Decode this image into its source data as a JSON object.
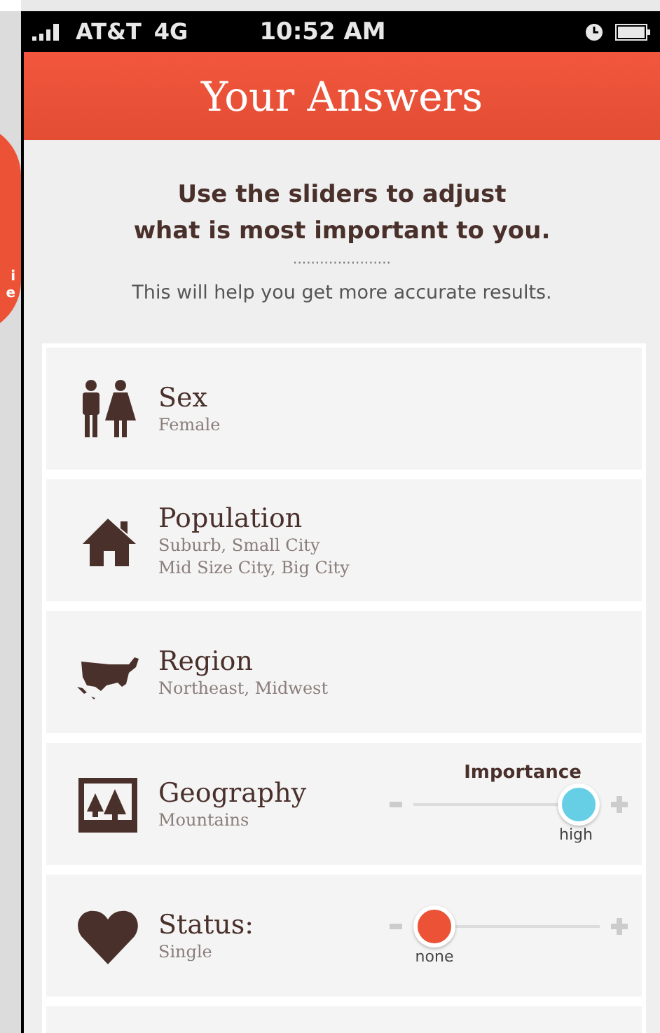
{
  "background_screen": {
    "badge_lines": [
      "i",
      "e"
    ]
  },
  "status_bar": {
    "carrier": "AT&T",
    "network": "4G",
    "time": "10:52 AM"
  },
  "header": {
    "title": "Your Answers"
  },
  "intro": {
    "heading_lines": [
      "Use the sliders to adjust",
      "what is most important to you."
    ],
    "divider": "......................",
    "subtitle": "This will help you get more accurate results."
  },
  "answers": [
    {
      "kind": "plain",
      "title": "Sex",
      "values": [
        "Female"
      ]
    },
    {
      "kind": "plain",
      "title": "Population",
      "values": [
        "Suburb, Small City",
        "Mid Size City, Big City"
      ]
    },
    {
      "kind": "plain",
      "title": "Region",
      "values": [
        "Northeast, Midwest"
      ]
    },
    {
      "kind": "slider",
      "title": "Geography",
      "values": [
        "Mountains"
      ],
      "slider_title": "Importance",
      "level": 1,
      "reading": "high",
      "color": "#66cfe6"
    },
    {
      "kind": "slider",
      "title": "Status:",
      "values": [
        "Single"
      ],
      "level": 0,
      "reading": "none",
      "color": "#ec5236"
    },
    {
      "kind": "empty"
    }
  ]
}
